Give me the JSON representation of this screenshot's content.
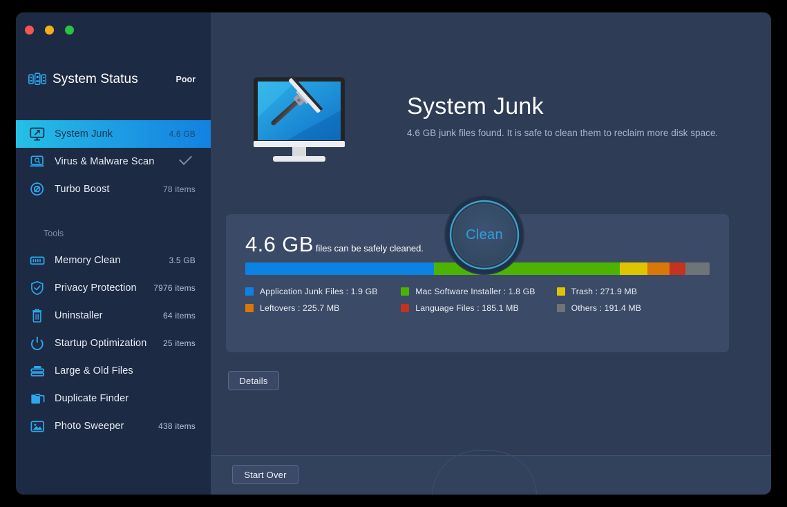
{
  "window": {
    "traffic_lights": [
      "close-button",
      "minimize-button",
      "maximize-button"
    ]
  },
  "sidebar": {
    "status": {
      "icon": "system-status-icon",
      "title": "System Status",
      "value": "Poor"
    },
    "nav_items": [
      {
        "icon": "monitor-junk-icon",
        "label": "System Junk",
        "value": "4.6 GB",
        "selected": true
      },
      {
        "icon": "malware-scan-icon",
        "label": "Virus & Malware Scan",
        "value": "",
        "check": true
      },
      {
        "icon": "turbo-boost-icon",
        "label": "Turbo Boost",
        "value": "78 items"
      }
    ],
    "tools_label": "Tools",
    "tools": [
      {
        "icon": "memory-icon",
        "label": "Memory Clean",
        "value": "3.5 GB"
      },
      {
        "icon": "shield-icon",
        "label": "Privacy Protection",
        "value": "7976 items"
      },
      {
        "icon": "trash-icon",
        "label": "Uninstaller",
        "value": "64 items"
      },
      {
        "icon": "power-icon",
        "label": "Startup Optimization",
        "value": "25 items"
      },
      {
        "icon": "stack-icon",
        "label": "Large & Old Files",
        "value": ""
      },
      {
        "icon": "copy-folder-icon",
        "label": "Duplicate Finder",
        "value": ""
      },
      {
        "icon": "photo-icon",
        "label": "Photo Sweeper",
        "value": "438 items"
      }
    ]
  },
  "hero": {
    "illustration": "monitor-with-squeegee-illustration",
    "title": "System Junk",
    "subtitle": "4.6 GB junk files found.  It is safe to clean them to reclaim more disk space."
  },
  "card": {
    "amount": "4.6 GB",
    "amount_suffix": "files can be safely cleaned."
  },
  "chart_data": {
    "type": "bar",
    "title": "System junk breakdown",
    "orientation": "horizontal-stacked",
    "total": "4.6 GB",
    "unit": "MB",
    "categories": [
      "Application Junk Files",
      "Mac Software Installer",
      "Trash",
      "Leftovers",
      "Language Files",
      "Others"
    ],
    "values_mb": [
      1945.6,
      1843.2,
      271.9,
      225.7,
      185.1,
      191.4
    ],
    "labels": [
      "1.9 GB",
      "1.8 GB",
      "271.9 MB",
      "225.7 MB",
      "185.1 MB",
      "191.4 MB"
    ],
    "colors": [
      "#0c83e2",
      "#4cb400",
      "#dfc500",
      "#d97708",
      "#c3331f",
      "#6f7478"
    ],
    "segment_order": [
      "Application Junk Files",
      "Mac Software Installer",
      "Trash",
      "Leftovers",
      "Language Files",
      "Others"
    ],
    "segment_widths_pct": [
      40.6,
      40.0,
      6.0,
      4.8,
      3.4,
      5.2
    ],
    "legend_position": "below",
    "grid": false
  },
  "legend": [
    {
      "color": "#0c83e2",
      "text": "Application Junk Files : 1.9 GB"
    },
    {
      "color": "#4cb400",
      "text": "Mac Software Installer : 1.8 GB"
    },
    {
      "color": "#dfc500",
      "text": "Trash : 271.9 MB"
    },
    {
      "color": "#d97708",
      "text": "Leftovers : 225.7 MB"
    },
    {
      "color": "#c3331f",
      "text": "Language Files : 185.1 MB"
    },
    {
      "color": "#6f7478",
      "text": "Others : 191.4 MB"
    }
  ],
  "buttons": {
    "details": "Details",
    "start_over": "Start Over",
    "clean": "Clean"
  },
  "colors": {
    "accent_blue": "#0c83e2",
    "sidebar_bg": "#1d2a44",
    "main_bg": "#2e3c56",
    "card_bg": "#3b4a66",
    "selected_start": "#24c0e6",
    "selected_end": "#1381e1",
    "clean_ring": "#2f9fe0"
  }
}
